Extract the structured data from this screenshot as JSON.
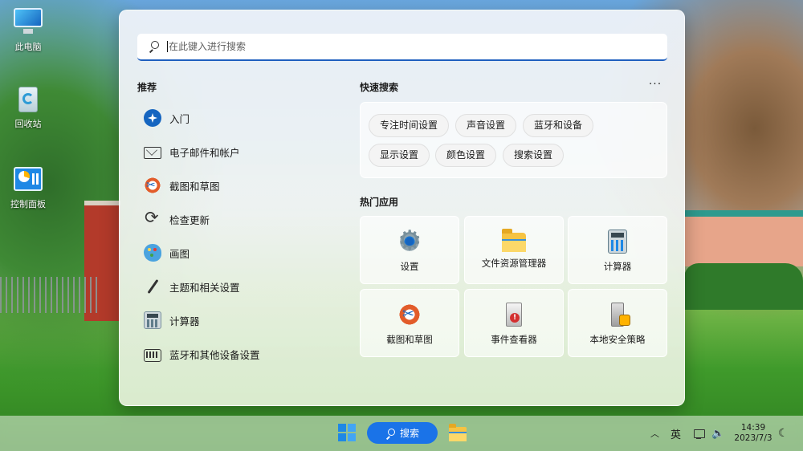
{
  "desktop": {
    "icons": [
      {
        "label": "此电脑",
        "icon": "computer-icon"
      },
      {
        "label": "回收站",
        "icon": "recycle-bin-icon"
      },
      {
        "label": "控制面板",
        "icon": "control-panel-icon"
      }
    ]
  },
  "search": {
    "placeholder": "在此键入进行搜索"
  },
  "recommended": {
    "title": "推荐",
    "items": [
      {
        "label": "入门",
        "icon": "get-started-icon"
      },
      {
        "label": "电子邮件和帐户",
        "icon": "mail-icon"
      },
      {
        "label": "截图和草图",
        "icon": "snip-sketch-icon"
      },
      {
        "label": "检查更新",
        "icon": "refresh-icon"
      },
      {
        "label": "画图",
        "icon": "paint-icon"
      },
      {
        "label": "主题和相关设置",
        "icon": "brush-icon"
      },
      {
        "label": "计算器",
        "icon": "calculator-icon"
      },
      {
        "label": "蓝牙和其他设备设置",
        "icon": "keyboard-device-icon"
      }
    ]
  },
  "quick_search": {
    "title": "快速搜索",
    "more_label": "···",
    "chips": [
      "专注时间设置",
      "声音设置",
      "蓝牙和设备",
      "显示设置",
      "颜色设置",
      "搜索设置"
    ]
  },
  "top_apps": {
    "title": "热门应用",
    "apps": [
      {
        "label": "设置",
        "icon": "settings-gear-icon"
      },
      {
        "label": "文件资源管理器",
        "icon": "folder-icon"
      },
      {
        "label": "计算器",
        "icon": "calculator-icon"
      },
      {
        "label": "截图和草图",
        "icon": "snip-sketch-icon"
      },
      {
        "label": "事件查看器",
        "icon": "event-viewer-icon"
      },
      {
        "label": "本地安全策略",
        "icon": "security-policy-icon"
      }
    ]
  },
  "taskbar": {
    "search_label": "搜索",
    "tray": {
      "chevron": "︿",
      "ime": "英",
      "volume": "🔈",
      "time": "14:39",
      "date": "2023/7/3",
      "moon": "☾"
    }
  },
  "colors": {
    "accent": "#1a73e8",
    "folder": "#f6c343"
  }
}
